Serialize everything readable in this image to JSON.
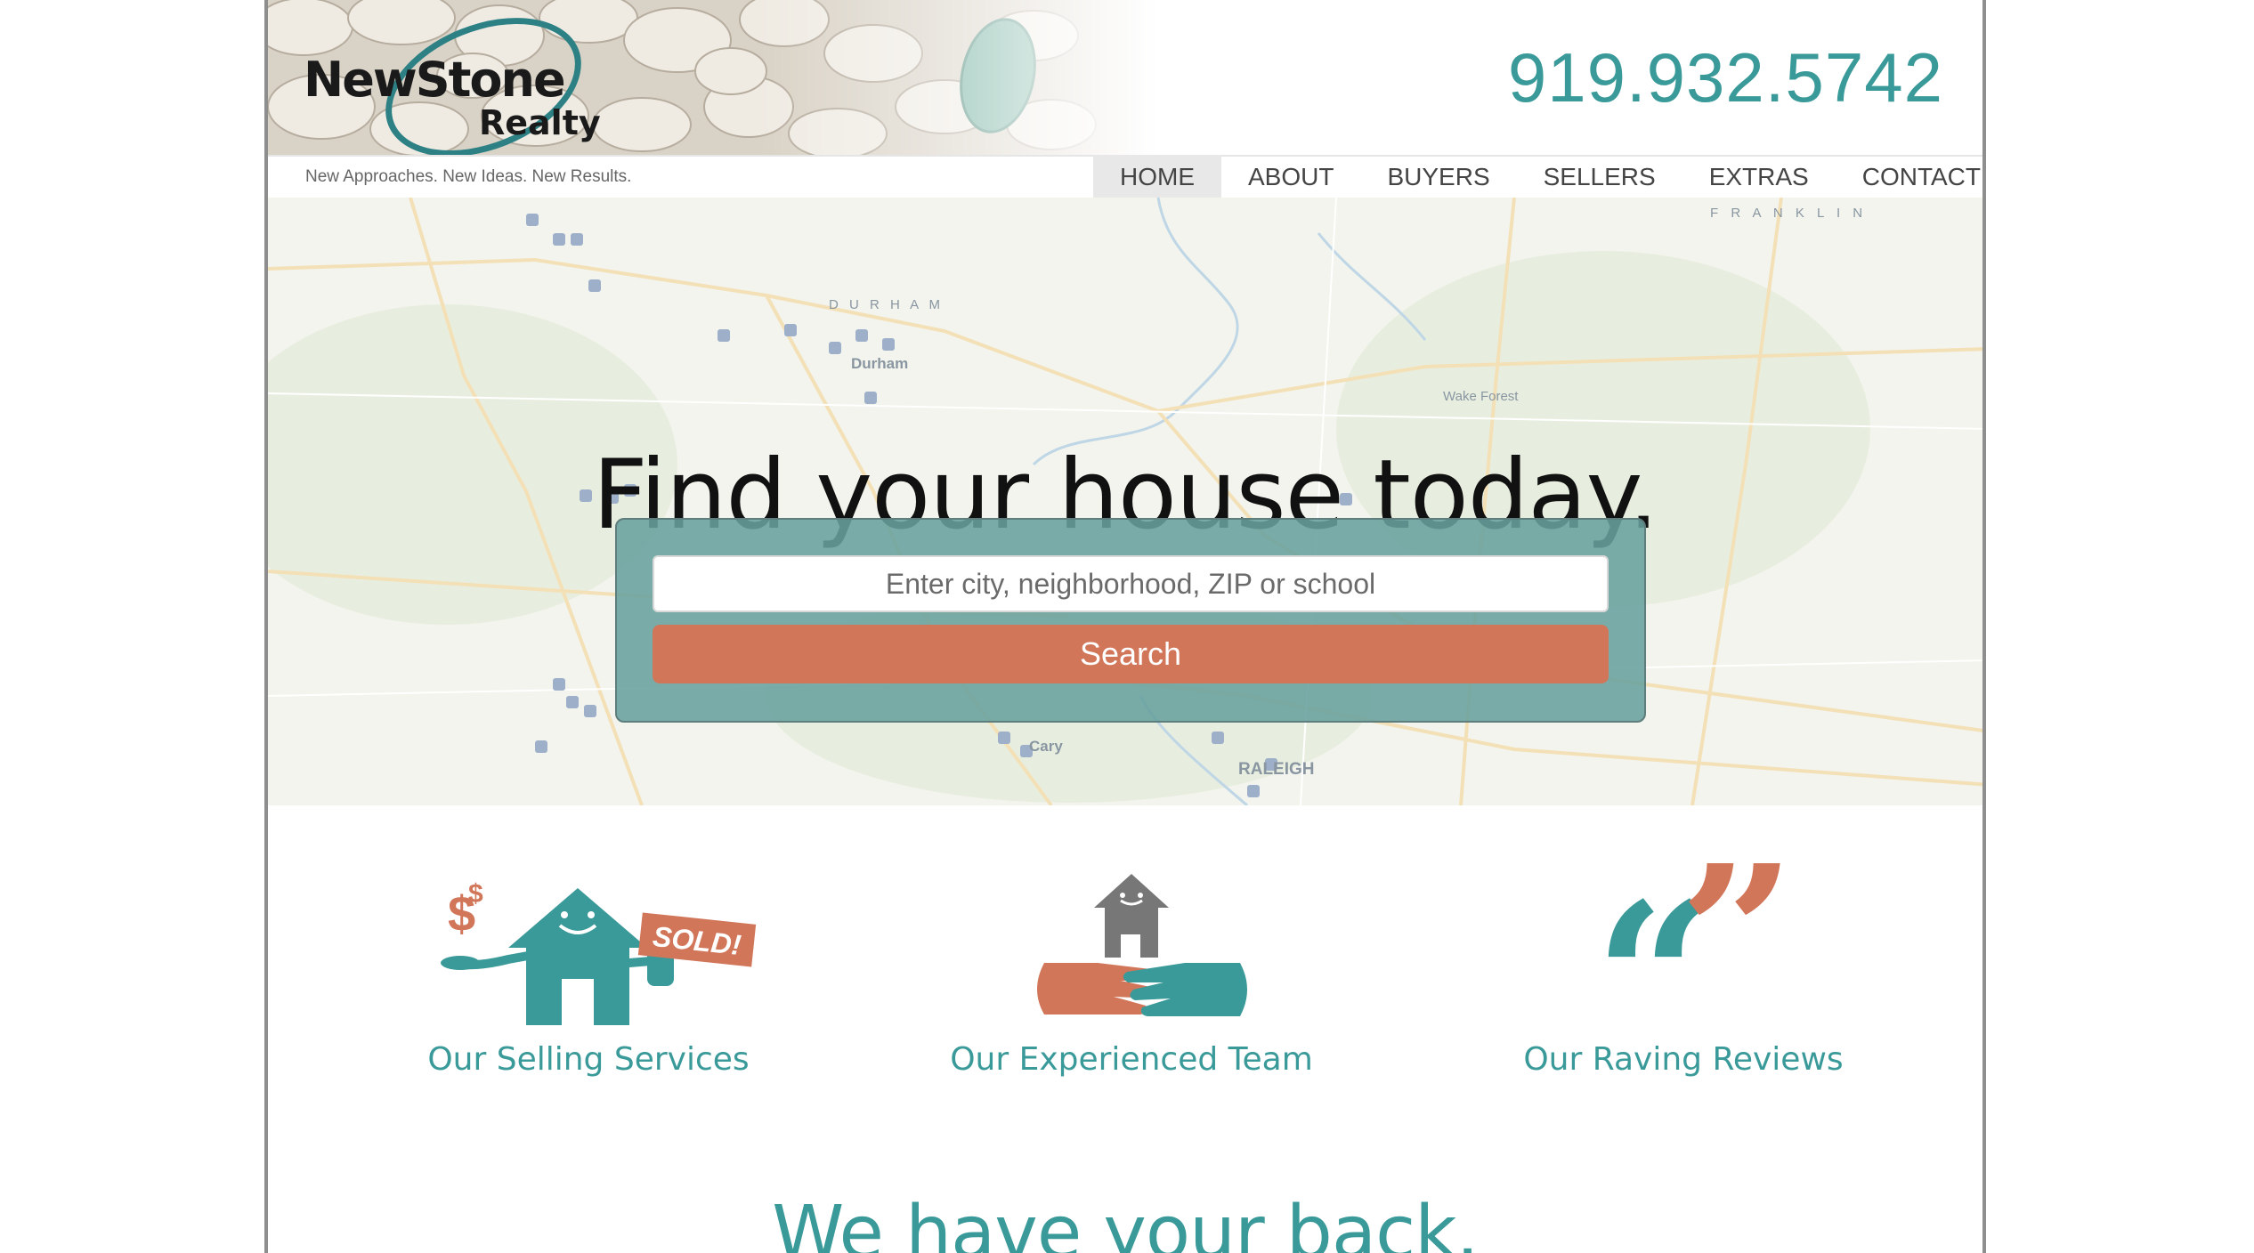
{
  "header": {
    "logo_main": "NewStone",
    "logo_sub": "Realty",
    "phone": "919.932.5742",
    "tagline": "New Approaches. New Ideas. New Results."
  },
  "nav": {
    "items": [
      {
        "label": "HOME",
        "active": true
      },
      {
        "label": "ABOUT"
      },
      {
        "label": "BUYERS"
      },
      {
        "label": "SELLERS"
      },
      {
        "label": "EXTRAS"
      },
      {
        "label": "CONTACT"
      }
    ]
  },
  "hero": {
    "title": "Find your house today.",
    "search_placeholder": "Enter city, neighborhood, ZIP or school",
    "search_button": "Search",
    "map_labels": {
      "durham_caps": "D U R H A M",
      "durham": "Durham",
      "raleigh": "RALEIGH",
      "cary": "Cary",
      "wake_forest": "Wake Forest",
      "franklin": "F R A N K L I N"
    }
  },
  "services": [
    {
      "label": "Our Selling Services",
      "icon": "sold-house-icon"
    },
    {
      "label": "Our Experienced Team",
      "icon": "handshake-house-icon"
    },
    {
      "label": "Our Raving Reviews",
      "icon": "quote-marks-icon"
    }
  ],
  "sold_text": "SOLD!",
  "tagline_bottom": "We have your back.",
  "colors": {
    "teal": "#3a9a99",
    "orange": "#d2765a",
    "search_panel": "#68a09e",
    "gray_house": "#777777"
  }
}
